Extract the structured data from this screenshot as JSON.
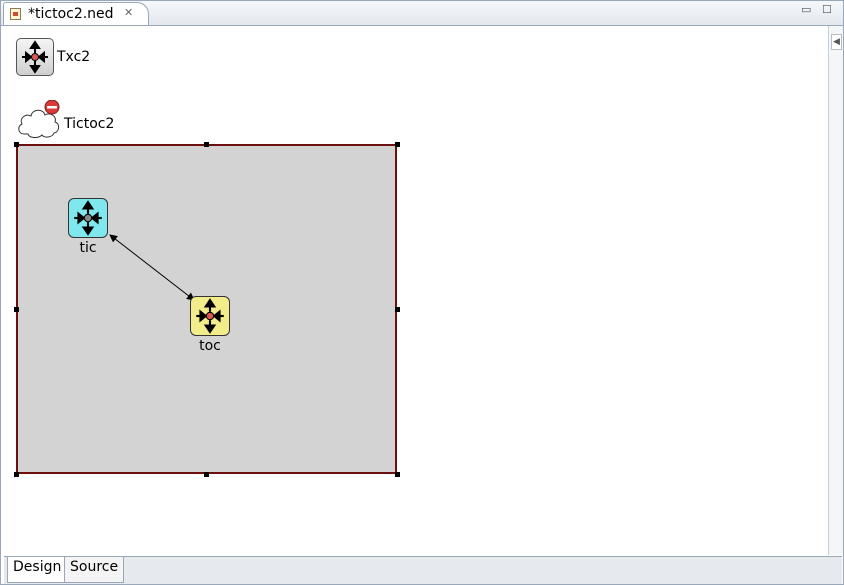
{
  "editor_tab": {
    "title": "*tictoc2.ned",
    "close": "✕"
  },
  "window": {
    "minimize": "▭",
    "maximize": "☐"
  },
  "palette": {
    "simple_module": "Txc2",
    "network": "Tictoc2"
  },
  "network": {
    "name": "Tictoc2",
    "modules": [
      {
        "name": "tic",
        "color": "#7fe7ee"
      },
      {
        "name": "toc",
        "color": "#f2ec8a"
      }
    ]
  },
  "bottom_tabs": [
    "Design",
    "Source"
  ],
  "colors": {
    "border": "#6b0f0f",
    "network_bg": "#d3d3d3"
  }
}
